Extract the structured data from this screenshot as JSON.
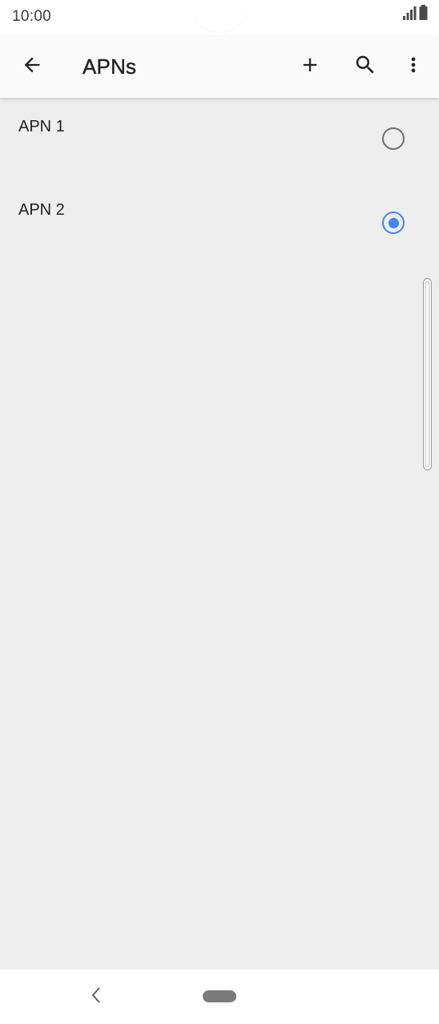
{
  "status_bar": {
    "time": "10:00",
    "icons": [
      "signal-icon",
      "battery-icon"
    ]
  },
  "app_bar": {
    "title": "APNs",
    "icons": [
      "back-arrow-icon",
      "add-icon",
      "search-icon",
      "more-vert-icon"
    ]
  },
  "apn_list": {
    "items": [
      {
        "name": "APN 1",
        "selected": false
      },
      {
        "name": "APN 2",
        "selected": true
      }
    ]
  },
  "nav_bar": {
    "icons": [
      "nav-back-icon",
      "home-pill-icon"
    ]
  },
  "colors": {
    "accent": "#4285f4",
    "background": "#eeeeee",
    "app_bar": "#fafafa",
    "text_primary": "#202124",
    "radio_unchecked": "#6e6e6e"
  }
}
